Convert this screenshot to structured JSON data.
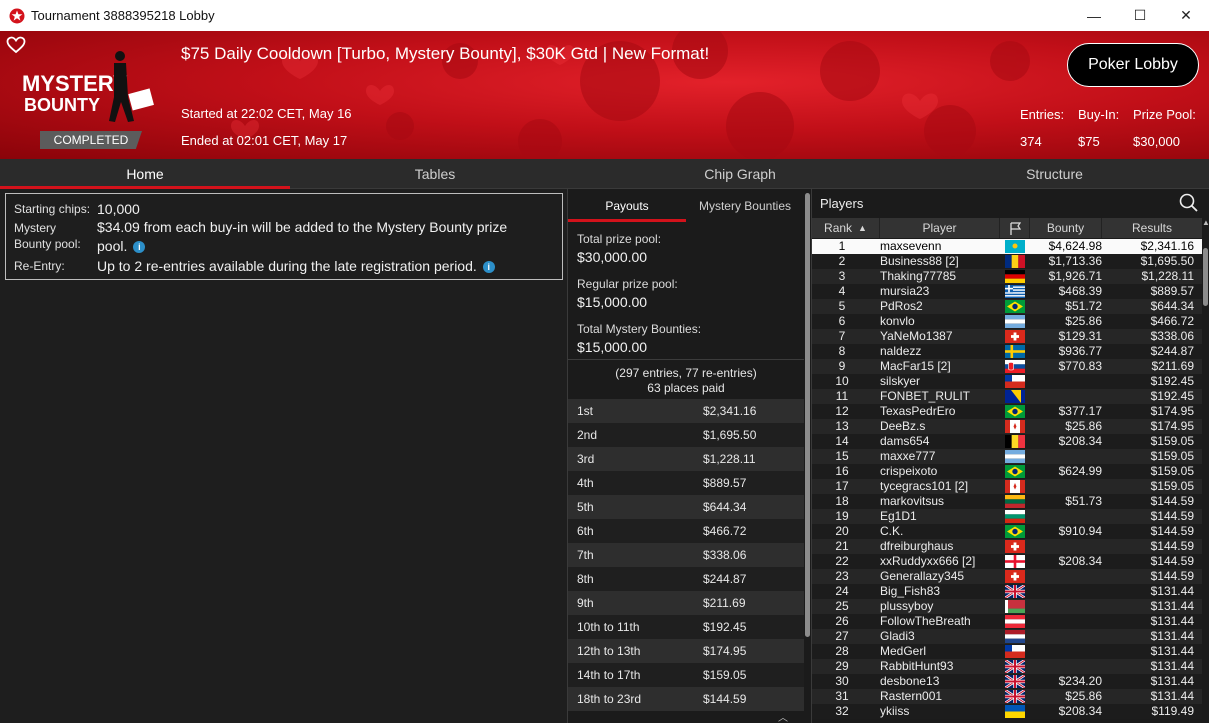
{
  "window": {
    "title": "Tournament 3888395218 Lobby",
    "min": "—",
    "max": "☐",
    "close": "✕"
  },
  "header": {
    "tournament_name": "$75 Daily Cooldown [Turbo, Mystery Bounty], $30K Gtd | New Format!",
    "started": "Started at 22:02 CET, May 16",
    "ended": "Ended at 02:01 CET, May 17",
    "status": "COMPLETED",
    "poker_lobby": "Poker Lobby",
    "logo_line1": "MYSTERY",
    "logo_line2": "BOUNTY",
    "stats": {
      "entries_label": "Entries:",
      "entries_value": "374",
      "buyin_label": "Buy-In:",
      "buyin_value": "$75",
      "prizepool_label": "Prize Pool:",
      "prizepool_value": "$30,000"
    }
  },
  "tabs": [
    "Home",
    "Tables",
    "Chip Graph",
    "Structure"
  ],
  "home": {
    "starting_chips_label": "Starting chips:",
    "starting_chips_value": "10,000",
    "bounty_label_1": "Mystery",
    "bounty_label_2": "Bounty pool:",
    "bounty_value_1": "$34.09 from each buy-in will be added to the Mystery Bounty prize",
    "bounty_value_2": "pool.",
    "reentry_label": "Re-Entry:",
    "reentry_value": "Up to 2 re-entries available during the late registration period."
  },
  "payouts": {
    "tab_payouts": "Payouts",
    "tab_bounties": "Mystery Bounties",
    "total_label": "Total prize pool:",
    "total_value": "$30,000.00",
    "regular_label": "Regular prize pool:",
    "regular_value": "$15,000.00",
    "bounties_label": "Total Mystery Bounties:",
    "bounties_value": "$15,000.00",
    "entries_line": "(297 entries, 77 re-entries)",
    "places_paid": "63 places paid",
    "places": [
      [
        "1st",
        "$2,341.16"
      ],
      [
        "2nd",
        "$1,695.50"
      ],
      [
        "3rd",
        "$1,228.11"
      ],
      [
        "4th",
        "$889.57"
      ],
      [
        "5th",
        "$644.34"
      ],
      [
        "6th",
        "$466.72"
      ],
      [
        "7th",
        "$338.06"
      ],
      [
        "8th",
        "$244.87"
      ],
      [
        "9th",
        "$211.69"
      ],
      [
        "10th to 11th",
        "$192.45"
      ],
      [
        "12th to 13th",
        "$174.95"
      ],
      [
        "14th to 17th",
        "$159.05"
      ],
      [
        "18th to 23rd",
        "$144.59"
      ]
    ]
  },
  "players": {
    "title": "Players",
    "columns": {
      "rank": "Rank",
      "player": "Player",
      "bounty": "Bounty",
      "results": "Results"
    },
    "rows": [
      [
        "1",
        "maxsevenn",
        "kz",
        "$4,624.98",
        "$2,341.16"
      ],
      [
        "2",
        "Business88 [2]",
        "ro",
        "$1,713.36",
        "$1,695.50"
      ],
      [
        "3",
        "Thaking77785",
        "de",
        "$1,926.71",
        "$1,228.11"
      ],
      [
        "4",
        "mursia23",
        "gr",
        "$468.39",
        "$889.57"
      ],
      [
        "5",
        "PdRos2",
        "br",
        "$51.72",
        "$644.34"
      ],
      [
        "6",
        "konvlo",
        "ar",
        "$25.86",
        "$466.72"
      ],
      [
        "7",
        "YaNeMo1387",
        "ch",
        "$129.31",
        "$338.06"
      ],
      [
        "8",
        "naldezz",
        "se",
        "$936.77",
        "$244.87"
      ],
      [
        "9",
        "MacFar15 [2]",
        "sk",
        "$770.83",
        "$211.69"
      ],
      [
        "10",
        "silskyer",
        "cl",
        "",
        "$192.45"
      ],
      [
        "11",
        "FONBET_RULIT",
        "ba",
        "",
        "$192.45"
      ],
      [
        "12",
        "TexasPedrEro",
        "br",
        "$377.17",
        "$174.95"
      ],
      [
        "13",
        "DeeBz.s",
        "ca",
        "$25.86",
        "$174.95"
      ],
      [
        "14",
        "dams654",
        "be",
        "$208.34",
        "$159.05"
      ],
      [
        "15",
        "maxxe777",
        "ar",
        "",
        "$159.05"
      ],
      [
        "16",
        "crispeixoto",
        "br",
        "$624.99",
        "$159.05"
      ],
      [
        "17",
        "tycegracs101 [2]",
        "ca",
        "",
        "$159.05"
      ],
      [
        "18",
        "markovitsus",
        "lt",
        "$51.73",
        "$144.59"
      ],
      [
        "19",
        "Eg1D1",
        "bg",
        "",
        "$144.59"
      ],
      [
        "20",
        "C.K.",
        "br",
        "$910.94",
        "$144.59"
      ],
      [
        "21",
        "dfreiburghaus",
        "ch",
        "",
        "$144.59"
      ],
      [
        "22",
        "xxRuddyxx666 [2]",
        "ge",
        "$208.34",
        "$144.59"
      ],
      [
        "23",
        "Generallazy345",
        "ch",
        "",
        "$144.59"
      ],
      [
        "24",
        "Big_Fish83",
        "gb",
        "",
        "$131.44"
      ],
      [
        "25",
        "plussyboy",
        "by",
        "",
        "$131.44"
      ],
      [
        "26",
        "FollowTheBreath",
        "at",
        "",
        "$131.44"
      ],
      [
        "27",
        "Gladi3",
        "nl",
        "",
        "$131.44"
      ],
      [
        "28",
        "MedGerl",
        "cl",
        "",
        "$131.44"
      ],
      [
        "29",
        "RabbitHunt93",
        "gb",
        "",
        "$131.44"
      ],
      [
        "30",
        "desbone13",
        "gb",
        "$234.20",
        "$131.44"
      ],
      [
        "31",
        "Rastern001",
        "gb",
        "$25.86",
        "$131.44"
      ],
      [
        "32",
        "ykiiss",
        "ua",
        "$208.34",
        "$119.49"
      ]
    ]
  },
  "colors": {
    "accent_red": "#d3121b",
    "header_red": "#c10f18",
    "panel_bg": "#1e1e1e"
  }
}
